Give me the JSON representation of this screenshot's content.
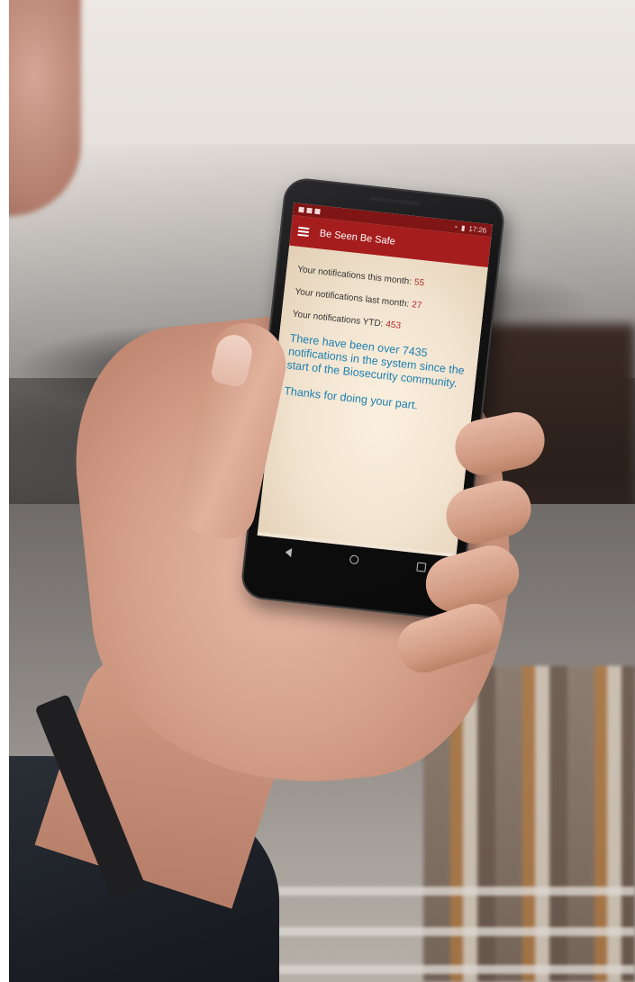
{
  "app": {
    "status_bar": {
      "time": "17:26"
    },
    "title": "Be Seen Be Safe",
    "stats": [
      {
        "label": "Your notifications this month:",
        "value": "55"
      },
      {
        "label": "Your notifications last month:",
        "value": "27"
      },
      {
        "label": "Your notifications YTD:",
        "value": "453"
      }
    ],
    "message": "There have been over 7435 notifications in the system since the start of the Biosecurity community.",
    "thanks": "Thanks for doing your part."
  },
  "colors": {
    "app_bar": "#a61d1d",
    "status_bar": "#7f1515",
    "stat_value": "#b32d2d",
    "message_text": "#1c7fb0",
    "screen_background": "#f1e5d5"
  },
  "icons": [
    "menu-icon",
    "wifi-icon",
    "battery-icon",
    "back-icon",
    "home-icon",
    "recents-icon"
  ]
}
